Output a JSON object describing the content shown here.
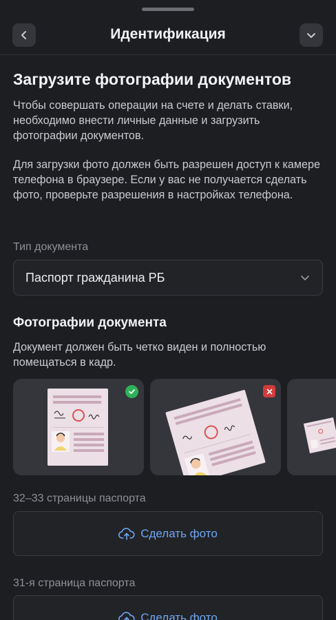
{
  "header": {
    "title": "Идентификация",
    "back_icon": "chevron-left-icon",
    "collapse_icon": "chevron-down-icon"
  },
  "main": {
    "heading": "Загрузите фотографии документов",
    "intro": "Чтобы совершать операции на счете и делать ставки, необходимо внести личные данные и загрузить фотографии документов.",
    "camera_note": "Для загрузки фото должен быть разрешен доступ к камере телефона в браузере. Если у вас не получается сделать фото, проверьте разрешения в настройках телефона.",
    "doc_type_label": "Тип документа",
    "doc_type_value": "Паспорт гражданина РБ",
    "photos_heading": "Фотографии документа",
    "photos_hint": "Документ должен быть четко виден и полностью помещаться в кадр.",
    "examples": [
      {
        "status": "correct",
        "icon": "check-icon"
      },
      {
        "status": "incorrect",
        "icon": "close-icon"
      },
      {
        "status": "example"
      }
    ],
    "uploads": [
      {
        "label": "32–33 страницы паспорта",
        "button": "Сделать фото",
        "icon": "upload-cloud-icon"
      },
      {
        "label": "31-я страница паспорта",
        "button": "Сделать фото",
        "icon": "upload-cloud-icon"
      }
    ]
  },
  "colors": {
    "background": "#1d1e22",
    "card": "#34363b",
    "accent_link": "#6ea7f2",
    "success": "#2fb15a",
    "error": "#d33b3b"
  }
}
